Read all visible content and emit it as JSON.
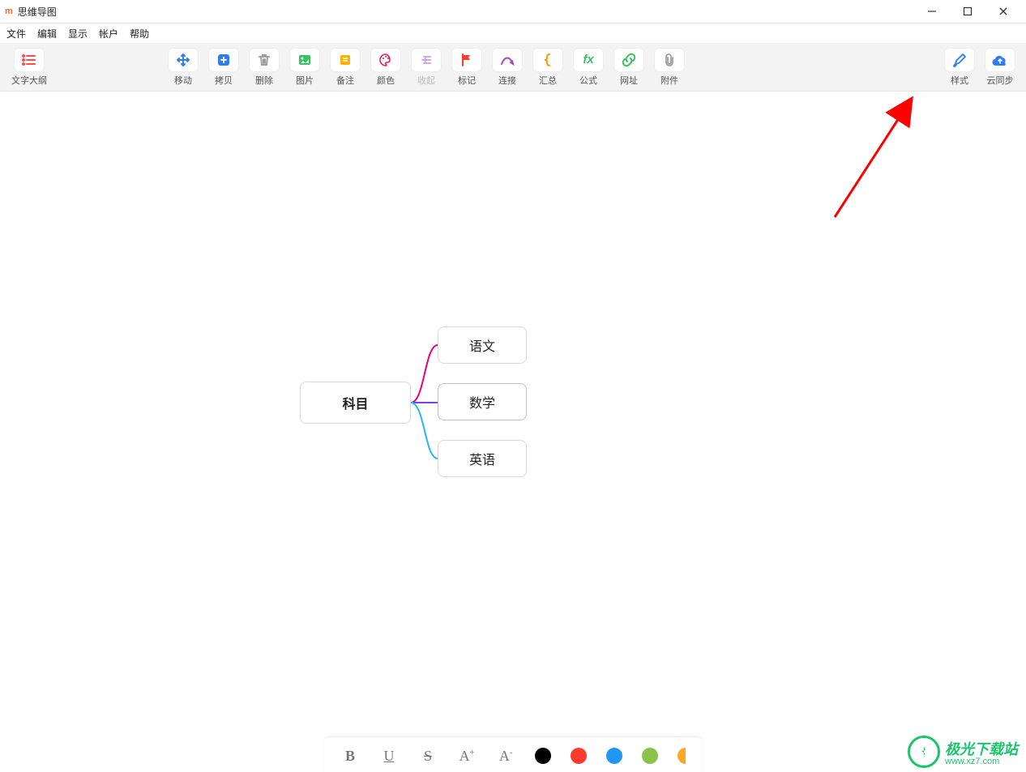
{
  "window": {
    "app_icon_text": "m",
    "title": "思维导图"
  },
  "menu": {
    "file": "文件",
    "edit": "编辑",
    "view": "显示",
    "account": "帐户",
    "help": "帮助"
  },
  "toolbar": {
    "outline": "文字大纲",
    "move": "移动",
    "copy": "拷贝",
    "delete": "删除",
    "image": "图片",
    "note": "备注",
    "color": "颜色",
    "collapse": "收起",
    "marker": "标记",
    "connect": "连接",
    "summary": "汇总",
    "formula": "公式",
    "url": "网址",
    "attachment": "附件",
    "style": "样式",
    "cloud_sync": "云同步"
  },
  "mindmap": {
    "root": "科目",
    "child1": "语文",
    "child2": "数学",
    "child3": "英语",
    "branch_colors": {
      "c1": "#e6007e",
      "c2": "#7b3ff2",
      "c3": "#24b6ff"
    }
  },
  "formatbar": {
    "bold": "B",
    "underline": "U",
    "strike": "S",
    "inc": "A⁺",
    "dec": "A⁻",
    "colors": [
      "#000000",
      "#ff3b30",
      "#2196f3",
      "#8bc34a",
      "#ffa726"
    ]
  },
  "watermark": {
    "line1": "极光下载站",
    "line2": "www.xz7.com"
  }
}
